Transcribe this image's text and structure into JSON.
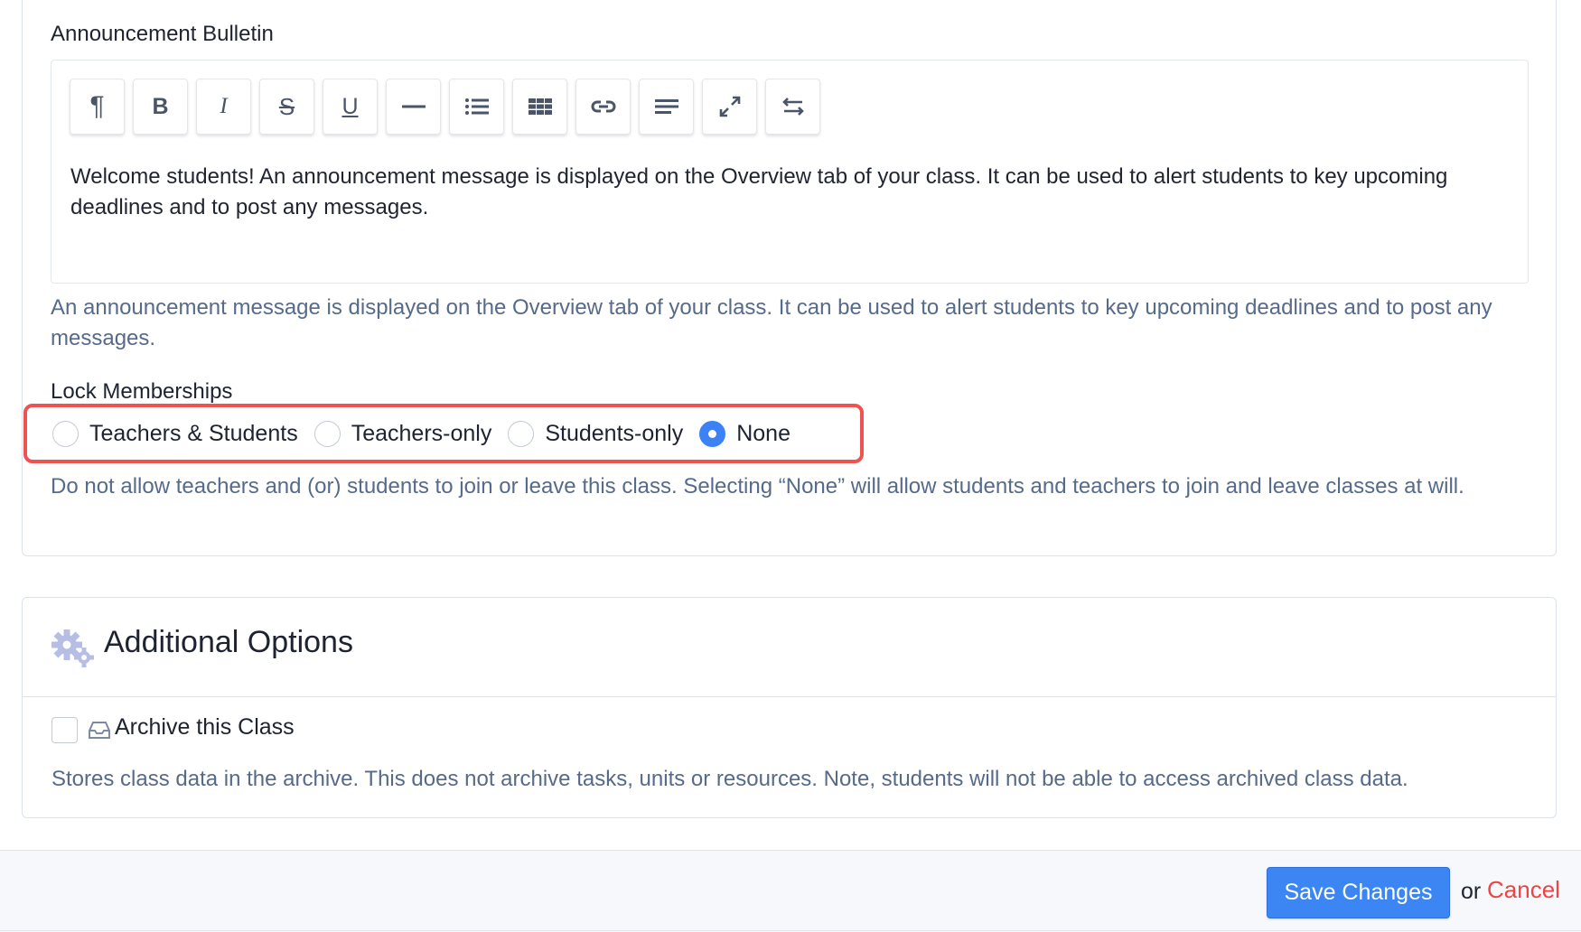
{
  "bulletin": {
    "label": "Announcement Bulletin",
    "toolbar": [
      {
        "name": "paragraph-icon"
      },
      {
        "name": "bold-icon"
      },
      {
        "name": "italic-icon"
      },
      {
        "name": "strikethrough-icon"
      },
      {
        "name": "underline-icon"
      },
      {
        "name": "horizontal-rule-icon"
      },
      {
        "name": "bullet-list-icon"
      },
      {
        "name": "table-icon"
      },
      {
        "name": "link-icon"
      },
      {
        "name": "align-left-icon"
      },
      {
        "name": "fullscreen-icon"
      },
      {
        "name": "swap-icon"
      }
    ],
    "content": "Welcome students! An announcement message is displayed on the Overview tab of your class. It can be used to alert students to key upcoming deadlines and to post any messages.",
    "help": "An announcement message is displayed on the Overview tab of your class. It can be used to alert students to key upcoming deadlines and to post any messages."
  },
  "lock": {
    "label": "Lock Memberships",
    "options": [
      {
        "label": "Teachers & Students",
        "checked": false
      },
      {
        "label": "Teachers-only",
        "checked": false
      },
      {
        "label": "Students-only",
        "checked": false
      },
      {
        "label": "None",
        "checked": true
      }
    ],
    "help": "Do not allow teachers and (or) students to join or leave this class. Selecting “None” will allow students and teachers to join and leave classes at will."
  },
  "additional": {
    "title": "Additional Options",
    "archive_label": "Archive this Class",
    "archive_checked": false,
    "archive_help": "Stores class data in the archive. This does not archive tasks, units or resources. Note, students will not be able to access archived class data."
  },
  "footer": {
    "save_label": "Save Changes",
    "or_text": "or",
    "cancel_label": "Cancel"
  },
  "colors": {
    "accent": "#3c86f4",
    "highlight": "#ef5350",
    "cancel": "#ef4444",
    "help_text": "#566a8a"
  }
}
